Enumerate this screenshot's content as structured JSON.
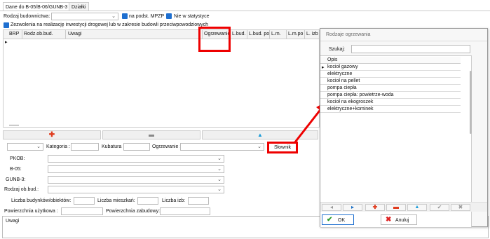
{
  "tabs": [
    "Dane do B-05/B-06/GUNB-3",
    "Działki"
  ],
  "filters": {
    "rodzaj_budownictwa_label": "Rodzaj budownictwa:",
    "na_podst_mpzp_label": "na podst. MPZP",
    "nie_w_statystyce_label": "Nie w statystyce",
    "zezwolenia_label": "Zezwolenia na realizację inwestycji drogowej lub w zakresie budowli przeciwpowodziowych"
  },
  "grid": {
    "columns": [
      "BRP",
      "Rodz.ob.bud.",
      "Uwagi",
      "Ogrzewanie",
      "L.bud.",
      "L.bud. po",
      "L.m.",
      "L.m.po",
      "L. izb"
    ],
    "row_marker": "▸"
  },
  "form": {
    "kategoria_label": "Kategoria :",
    "kubatura_label": "Kubatura :",
    "ogrzewanie_label": "Ogrzewanie :",
    "slownik_label": "Słownik",
    "pkob_label": "PKOB:",
    "b05_label": "B-05:",
    "gunb3_label": "GUNB-3:",
    "rodzaj_ob_bud_label": "Rodzaj ob.bud.:",
    "liczba_budynkow_label": "Liczba budynków/obiektów:",
    "liczba_mieszkan_label": "Liczba mieszkań:",
    "liczba_izb_label": "Liczba izb:",
    "powierzchnia_uzytkowa_label": "Powierzchnia użytkowa :",
    "powierzchnia_zabudowy_label": "Powierzchnia zabudowy:",
    "uwagi_label": "Uwagi"
  },
  "dialog": {
    "title": "Rodzaje ogrzewania",
    "search_label": "Szukaj:",
    "list_header": "Opis",
    "items": [
      "kocioł gazowy",
      "elektryczne",
      "kocioł na pellet",
      "pompa ciepła",
      "pompa ciepła: powietrze-woda",
      "kocioł na ekogroszek",
      "elektryczne+kominek"
    ],
    "ok_label": "OK",
    "cancel_label": "Anuluj"
  },
  "colors": {
    "accent": "#1e6fd0",
    "highlight": "#e00000",
    "add": "#e03c1e",
    "delete": "#e03c1e",
    "up": "#1a9bd8"
  }
}
